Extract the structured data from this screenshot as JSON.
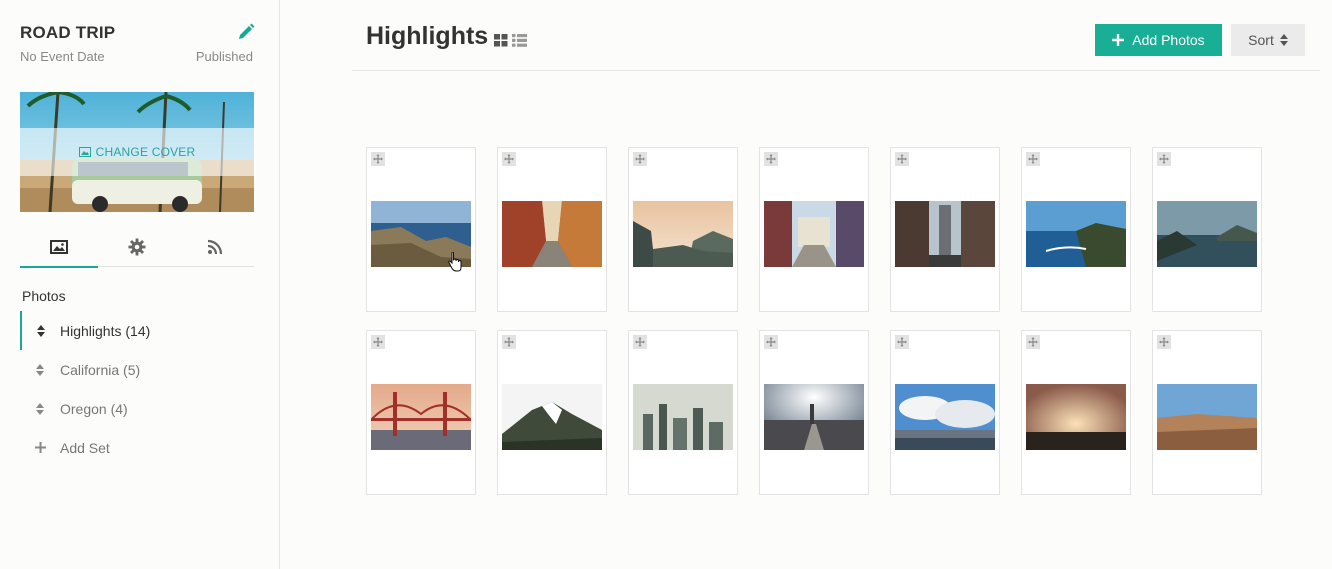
{
  "event": {
    "title": "ROAD TRIP",
    "date": "No Event Date",
    "status": "Published"
  },
  "cover": {
    "label": "CHANGE COVER"
  },
  "tabs": [
    {
      "name": "tab-photos",
      "icon": "image-icon",
      "active": true
    },
    {
      "name": "tab-settings",
      "icon": "gear-icon",
      "active": false
    },
    {
      "name": "tab-feed",
      "icon": "rss-icon",
      "active": false
    }
  ],
  "sets": {
    "heading": "Photos",
    "items": [
      {
        "label": "Highlights (14)",
        "active": true
      },
      {
        "label": "California (5)",
        "active": false
      },
      {
        "label": "Oregon (4)",
        "active": false
      }
    ],
    "add_label": "Add Set"
  },
  "main": {
    "title": "Highlights",
    "add_label": "Add Photos",
    "sort_label": "Sort"
  },
  "colors": {
    "accent": "#19ae96",
    "accent_dark": "#19a797"
  }
}
